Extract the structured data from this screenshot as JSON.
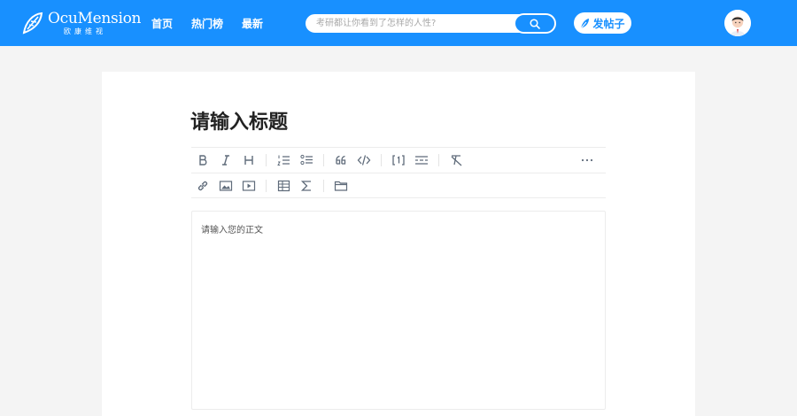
{
  "header": {
    "logo": {
      "name": "OcuMension",
      "sub": "欧康维视"
    },
    "nav": [
      {
        "label": "首页"
      },
      {
        "label": "热门榜"
      },
      {
        "label": "最新"
      }
    ],
    "search": {
      "placeholder": "考研都让你看到了怎样的人性?"
    },
    "post_button": {
      "label": "发帖子"
    }
  },
  "editor": {
    "title_placeholder": "请输入标题",
    "body_placeholder": "请输入您的正文",
    "toolbar_row1": [
      "bold-icon",
      "italic-icon",
      "heading-icon",
      "ordered-list-icon",
      "bullet-list-icon",
      "quote-icon",
      "code-icon",
      "footnote-icon",
      "horizontal-rule-icon",
      "clear-format-icon",
      "more-icon"
    ],
    "toolbar_row2": [
      "link-icon",
      "image-icon",
      "video-icon",
      "table-icon",
      "formula-icon",
      "folder-icon"
    ]
  },
  "colors": {
    "brand": "#1890ff",
    "icon": "#5f6b7a",
    "background": "#f4f4f4"
  }
}
